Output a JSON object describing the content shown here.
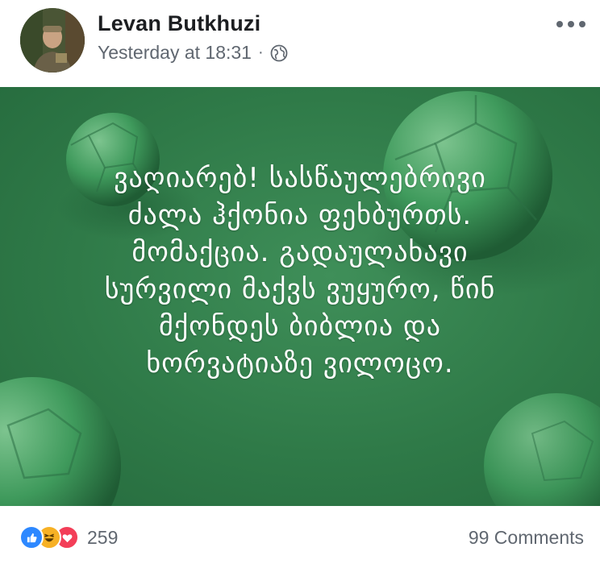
{
  "post": {
    "author": "Levan Butkhuzi",
    "timestamp": "Yesterday at 18:31",
    "separator": "·",
    "privacy_icon": "globe-icon",
    "more_icon": "more-options-icon"
  },
  "image": {
    "background_color": "#2f7a48",
    "lines": [
      "ვაღიარებ! სასწაულებრივი",
      "ძალა ჰქონია ფეხბურთს.",
      "მომაქცია. გადაულახავი",
      "სურვილი მაქვს ვუყურო, წინ",
      "მქონდეს ბიბლია და",
      "ხორვატიაზე ვილოცო."
    ]
  },
  "footer": {
    "reaction_icons": [
      "like-icon",
      "haha-icon",
      "love-icon"
    ],
    "reaction_count": "259",
    "comments": "99 Comments"
  },
  "colors": {
    "like": "#2d88ff",
    "haha": "#f7b125",
    "love": "#f33e58",
    "text_secondary": "#606770"
  }
}
